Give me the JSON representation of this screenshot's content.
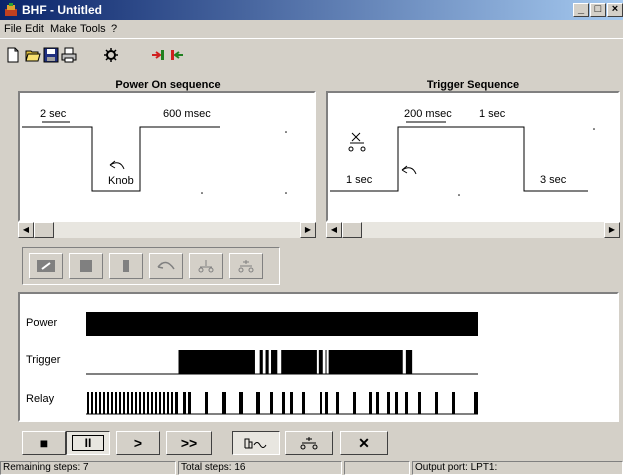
{
  "window": {
    "title": "BHF - Untitled",
    "min_label": "_",
    "max_label": "□",
    "close_label": "×"
  },
  "menu": [
    "File",
    "Edit",
    "Make",
    "Tools",
    "?"
  ],
  "power_panel": {
    "title": "Power On sequence",
    "labels": {
      "t1": "2 sec",
      "t2": "600 msec",
      "knob": "Knob"
    }
  },
  "trigger_panel": {
    "title": "Trigger Sequence",
    "labels": {
      "t1": "200 msec",
      "t2": "1 sec",
      "left": "1 sec",
      "right": "3 sec"
    }
  },
  "timeline": {
    "tracks": [
      {
        "label": "Power",
        "segments": [
          [
            0,
            1
          ]
        ]
      },
      {
        "label": "Trigger",
        "segments": [
          [
            0.236,
            0.431
          ],
          [
            0.443,
            0.451
          ],
          [
            0.458,
            0.466
          ],
          [
            0.472,
            0.488
          ],
          [
            0.498,
            0.589
          ],
          [
            0.594,
            0.604
          ],
          [
            0.611,
            0.613
          ],
          [
            0.619,
            0.808
          ],
          [
            0.816,
            0.832
          ]
        ]
      },
      {
        "label": "Relay",
        "segments": []
      }
    ]
  },
  "controls": {
    "stop": "■",
    "pause": "II",
    "play": ">",
    "fast": ">>",
    "close": "✕"
  },
  "status": {
    "remaining": "Remaining steps: 7",
    "total": "Total steps: 16",
    "blank": "",
    "port": "Output port: LPT1:"
  }
}
